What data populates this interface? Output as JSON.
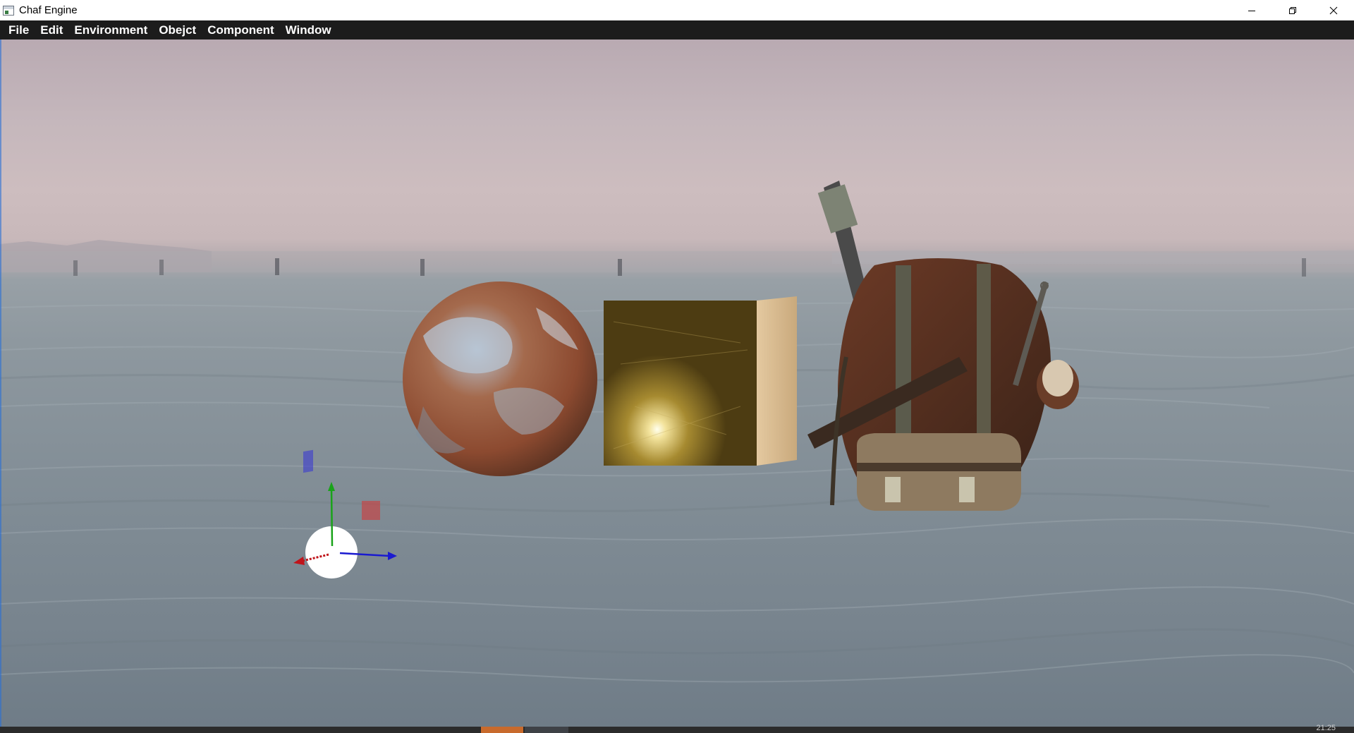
{
  "window": {
    "title": "Chaf Engine",
    "icon": "app-window-icon",
    "controls": [
      "minimize-icon",
      "restore-icon",
      "close-icon"
    ]
  },
  "menubar": {
    "items": [
      {
        "label": "File"
      },
      {
        "label": "Edit"
      },
      {
        "label": "Environment"
      },
      {
        "label": "Obejct"
      },
      {
        "label": "Component"
      },
      {
        "label": "Window"
      }
    ]
  },
  "viewport": {
    "scene_objects": [
      "rusted-metal-sphere",
      "gold-cube",
      "backpack-model",
      "point-light-gizmo"
    ],
    "gizmo_axes": {
      "x": "#c0141b",
      "y": "#1aa31a",
      "z": "#1a1ad0"
    }
  },
  "statusbar": {
    "text": "21:25"
  },
  "colors": {
    "titlebar_bg": "#ffffff",
    "menubar_bg": "#1c1c1c",
    "menu_text": "#ffffff",
    "statusbar_bg": "#2b2b2b",
    "active_tab": "#c86a2c"
  }
}
